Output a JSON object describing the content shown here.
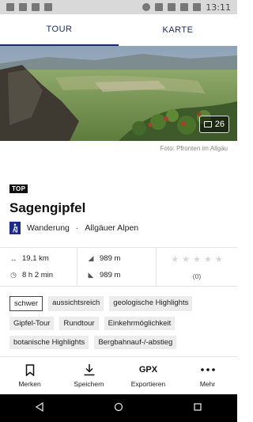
{
  "status_bar": {
    "time": "13:11"
  },
  "tabs": [
    {
      "label": "TOUR",
      "active": true
    },
    {
      "label": "KARTE",
      "active": false
    }
  ],
  "hero": {
    "gallery_count": "26",
    "photo_credit": "Foto: Pfronten im Allgäu"
  },
  "tour": {
    "badge": "TOP",
    "title": "Sagengipfel",
    "category": "Wanderung",
    "separator": "·",
    "region": "Allgäuer Alpen"
  },
  "stats": {
    "distance": "19,1 km",
    "duration": "8 h 2 min",
    "ascent": "989 m",
    "descent": "989 m",
    "rating_count": "(0)",
    "stars_filled": 0,
    "stars_total": 5
  },
  "tags": [
    {
      "label": "schwer",
      "outlined": true
    },
    {
      "label": "aussichtsreich"
    },
    {
      "label": "geologische Highlights"
    },
    {
      "label": "Gipfel-Tour"
    },
    {
      "label": "Rundtour"
    },
    {
      "label": "Einkehrmöglichkeit"
    },
    {
      "label": "botanische Highlights"
    },
    {
      "label": "Bergbahnauf-/-abstieg"
    }
  ],
  "actions": {
    "merken": "Merken",
    "speichern": "Speichern",
    "gpx_icon": "GPX",
    "exportieren": "Exportieren",
    "mehr": "Mehr"
  },
  "colors": {
    "accent": "#1a2b6b",
    "hiker_badge": "#1a2b8b"
  }
}
